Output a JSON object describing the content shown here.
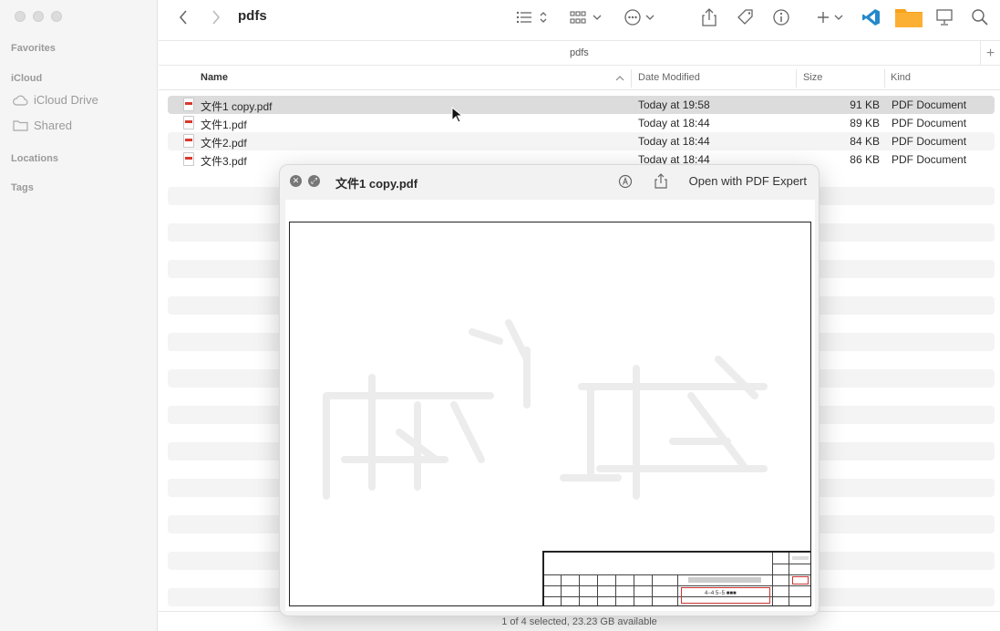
{
  "window": {
    "title": "pdfs",
    "path_label": "pdfs"
  },
  "sidebar": {
    "sections": [
      {
        "label": "Favorites"
      },
      {
        "label": "iCloud"
      },
      {
        "label": "Locations"
      },
      {
        "label": "Tags"
      }
    ],
    "items": [
      {
        "label": "iCloud Drive",
        "icon": "cloud-icon"
      },
      {
        "label": "Shared",
        "icon": "shared-folder-icon"
      }
    ]
  },
  "columns": {
    "name": "Name",
    "date": "Date Modified",
    "size": "Size",
    "kind": "Kind"
  },
  "files": [
    {
      "name": "文件1 copy.pdf",
      "date": "Today at 19:58",
      "size": "91 KB",
      "kind": "PDF Document",
      "selected": true
    },
    {
      "name": "文件1.pdf",
      "date": "Today at 18:44",
      "size": "89 KB",
      "kind": "PDF Document",
      "selected": false
    },
    {
      "name": "文件2.pdf",
      "date": "Today at 18:44",
      "size": "84 KB",
      "kind": "PDF Document",
      "selected": false
    },
    {
      "name": "文件3.pdf",
      "date": "Today at 18:44",
      "size": "86 KB",
      "kind": "PDF Document",
      "selected": false
    }
  ],
  "status": "1 of 4 selected, 23.23 GB available",
  "quicklook": {
    "title": "文件1 copy.pdf",
    "open_with": "Open with PDF Expert",
    "title_block": {
      "drawing_title": "4−4 5−5 ■■■"
    }
  },
  "colors": {
    "accent_folder": "#f7a21b",
    "vscode": "#2489ca",
    "pdf_red": "#d73a2e",
    "selection": "#dcdcdc"
  }
}
